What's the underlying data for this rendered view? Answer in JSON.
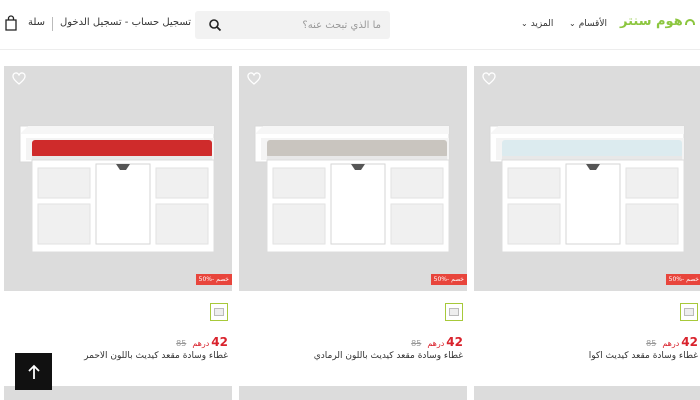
{
  "header": {
    "cart_label": "سلة",
    "account_label": "تسجيل حساب - تسجيل الدخول",
    "search": {
      "placeholder": "ما الذي تبحث عنه؟"
    },
    "nav": {
      "more_label": "المزيد",
      "categories_label": "الأقسام"
    },
    "logo_text": "هوم سنتر",
    "brand_color": "#8cc63f"
  },
  "products": [
    {
      "title": "غطاء وسادة مقعد كيديث أكوا",
      "price": "42",
      "currency": "درهم",
      "old_price": "85",
      "discount": "50%- خصم",
      "cushion_color": "#dcebef"
    },
    {
      "title": "غطاء وسادة مقعد كيديث باللون الرمادي",
      "price": "42",
      "currency": "درهم",
      "old_price": "85",
      "discount": "50%- خصم",
      "cushion_color": "#c9c5bf"
    },
    {
      "title": "غطاء وسادة مقعد كيديث باللون الأحمر",
      "price": "42",
      "currency": "درهم",
      "old_price": "85",
      "discount": "50%- خصم",
      "cushion_color": "#cf2b2b"
    }
  ],
  "icons": {
    "cart": "shopping-bag-icon",
    "search": "search-icon",
    "heart": "heart-icon",
    "to_top": "arrow-up-icon"
  },
  "colors": {
    "price": "#d9232d",
    "discount_bg": "#e8453c"
  }
}
